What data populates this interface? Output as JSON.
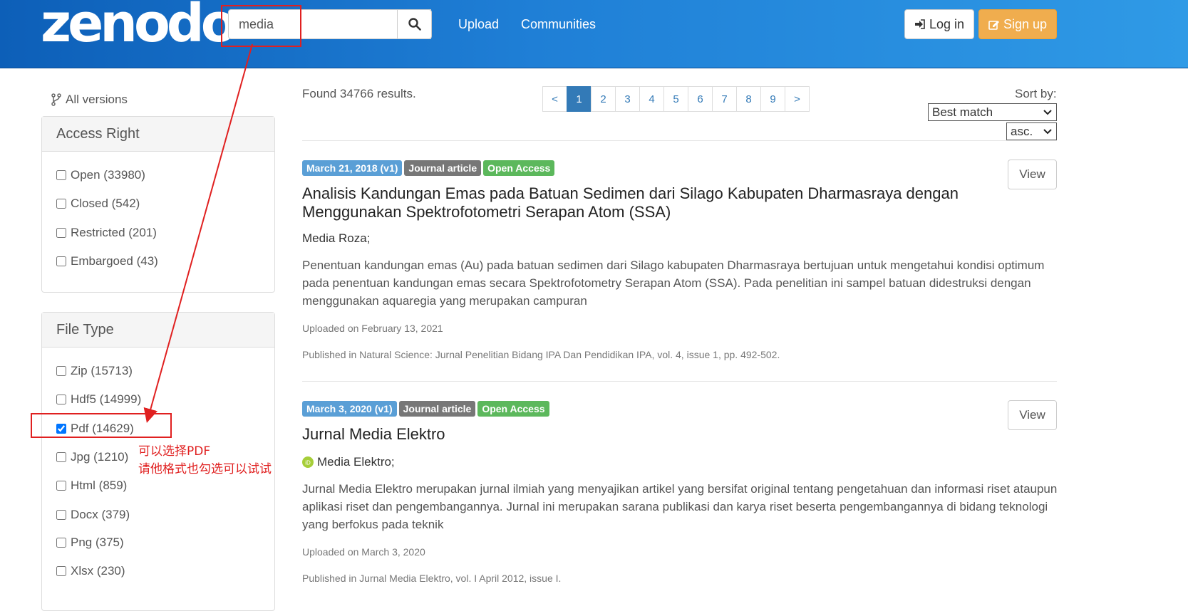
{
  "header": {
    "logo": "zenodo",
    "search_value": "media",
    "nav": [
      "Upload",
      "Communities"
    ],
    "login_label": "Log in",
    "signup_label": "Sign up"
  },
  "sidebar": {
    "all_versions": "All versions",
    "access_right": {
      "title": "Access Right",
      "items": [
        {
          "label": "Open (33980)",
          "checked": false
        },
        {
          "label": "Closed (542)",
          "checked": false
        },
        {
          "label": "Restricted (201)",
          "checked": false
        },
        {
          "label": "Embargoed (43)",
          "checked": false
        }
      ]
    },
    "file_type": {
      "title": "File Type",
      "items": [
        {
          "label": "Zip (15713)",
          "checked": false
        },
        {
          "label": "Hdf5 (14999)",
          "checked": false
        },
        {
          "label": "Pdf (14629)",
          "checked": true
        },
        {
          "label": "Jpg (1210)",
          "checked": false
        },
        {
          "label": "Html (859)",
          "checked": false
        },
        {
          "label": "Docx (379)",
          "checked": false
        },
        {
          "label": "Png (375)",
          "checked": false
        },
        {
          "label": "Xlsx (230)",
          "checked": false
        }
      ]
    }
  },
  "results": {
    "found": "Found 34766 results.",
    "pages": [
      "<",
      "1",
      "2",
      "3",
      "4",
      "5",
      "6",
      "7",
      "8",
      "9",
      ">"
    ],
    "active_page": "1",
    "sort_label": "Sort by:",
    "sort_value": "Best match",
    "order_value": "asc.",
    "items": [
      {
        "date": "March 21, 2018 (v1)",
        "type": "Journal article",
        "access": "Open Access",
        "title": "Analisis Kandungan Emas pada Batuan Sedimen dari Silago Kabupaten Dharmasraya dengan Menggunakan Spektrofotometri Serapan Atom (SSA)",
        "author": "Media Roza;",
        "description": "Penentuan kandungan emas (Au) pada batuan sedimen dari Silago kabupaten Dharmasraya bertujuan untuk mengetahui kondisi optimum pada penentuan kandungan emas secara Spektrofotometry Serapan Atom (SSA). Pada penelitian ini sampel batuan didestruksi dengan menggunakan aquaregia yang merupakan campuran",
        "uploaded": "Uploaded on February 13, 2021",
        "published": "Published in Natural Science: Jurnal Penelitian Bidang IPA Dan Pendidikan IPA, vol. 4, issue 1, pp. 492-502.",
        "view_label": "View"
      },
      {
        "date": "March 3, 2020 (v1)",
        "type": "Journal article",
        "access": "Open Access",
        "title": "Jurnal Media Elektro",
        "author": "Media Elektro;",
        "description": "Jurnal Media Elektro merupakan jurnal ilmiah yang menyajikan artikel yang bersifat original tentang pengetahuan dan informasi riset ataupun aplikasi riset dan pengembangannya. Jurnal ini merupakan sarana publikasi dan karya riset beserta pengembangannya di bidang teknologi yang berfokus pada teknik",
        "uploaded": "Uploaded on March 3, 2020",
        "published": "Published in Jurnal Media Elektro, vol. I April 2012, issue I.",
        "view_label": "View"
      }
    ]
  },
  "annotation": {
    "line1": "可以选择PDF",
    "line2": "请他格式也勾选可以试试"
  },
  "colors": {
    "date_badge": "#5a9fd6",
    "type_badge": "#777777",
    "access_badge": "#5cb85c",
    "annotation": "#e02020",
    "signup": "#f0ad4e"
  }
}
